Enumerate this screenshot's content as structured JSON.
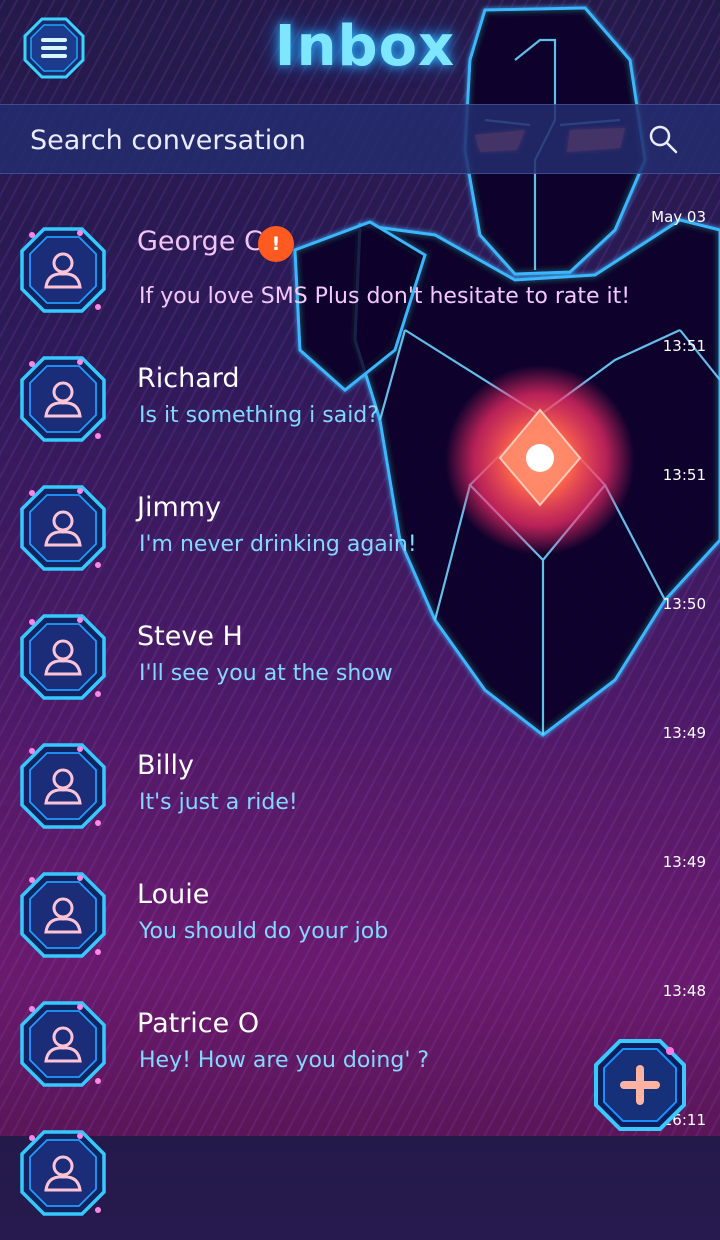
{
  "header": {
    "title": "Inbox",
    "menu_icon": "menu-icon"
  },
  "search": {
    "placeholder": "Search conversation",
    "icon": "search-icon"
  },
  "conversations": [
    {
      "name": "George C",
      "message": "If you love SMS Plus don't hesitate to rate it!",
      "time": "May 03",
      "unread_badge": "!"
    },
    {
      "name": "Richard",
      "message": "Is it something i said?",
      "time": "13:51"
    },
    {
      "name": "Jimmy",
      "message": "I'm never drinking again!",
      "time": "13:51"
    },
    {
      "name": "Steve H",
      "message": "I'll see you at the show",
      "time": "13:50"
    },
    {
      "name": "Billy",
      "message": "It's just a ride!",
      "time": "13:49"
    },
    {
      "name": "Louie",
      "message": "You should do your job",
      "time": "13:49"
    },
    {
      "name": "Patrice O",
      "message": "Hey! How are you doing' ?",
      "time": "13:48"
    },
    {
      "name": "",
      "message": "",
      "time": "16:11"
    }
  ],
  "fab": {
    "icon": "plus-icon"
  },
  "colors": {
    "accent": "#7fe6ff",
    "badge": "#ff5a1f",
    "message_text": "#84d8ff",
    "background": "#2d1a58"
  }
}
